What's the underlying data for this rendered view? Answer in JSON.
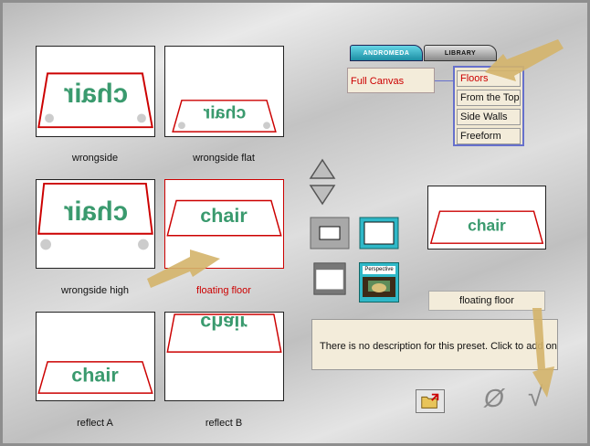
{
  "presets": [
    {
      "label": "wrongside",
      "selected": false
    },
    {
      "label": "wrongside flat",
      "selected": false
    },
    {
      "label": "wrongside high",
      "selected": false
    },
    {
      "label": "floating floor",
      "selected": true
    },
    {
      "label": "reflect A",
      "selected": false
    },
    {
      "label": "reflect B",
      "selected": false
    }
  ],
  "thumb_text": "chair",
  "tabs": {
    "andromeda": "ANDROMEDA",
    "library": "LIBRARY"
  },
  "category": "Full Canvas",
  "menu": [
    "Floors",
    "From the Top",
    "Side Walls",
    "Freeform"
  ],
  "preset_name": "floating floor",
  "description": "There is no description for this preset. Click to add one",
  "perspective_label": "Perspective",
  "icons": {
    "up": "triangle-up-icon",
    "down": "triangle-down-icon",
    "cancel": "cancel-circle-slash-icon",
    "ok": "checkmark-icon",
    "folder": "folder-open-icon"
  },
  "colors": {
    "accent_red": "#cc0000",
    "menu_border": "#6670cc",
    "chair_green": "#3a9a6e",
    "arrow": "#d4b46a"
  }
}
